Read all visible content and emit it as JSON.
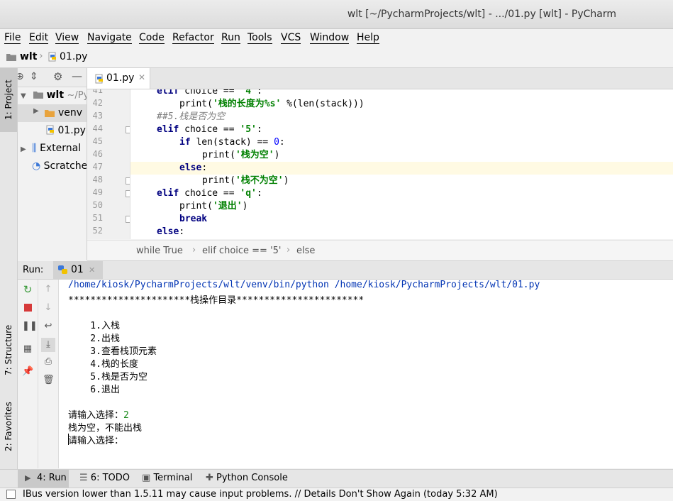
{
  "window": {
    "title": "wlt [~/PycharmProjects/wlt] - .../01.py [wlt] - PyCharm"
  },
  "menu": [
    "File",
    "Edit",
    "View",
    "Navigate",
    "Code",
    "Refactor",
    "Run",
    "Tools",
    "VCS",
    "Window",
    "Help"
  ],
  "nav": {
    "project": "wlt",
    "file": "01.py"
  },
  "sidebar": {
    "project_tab": "1: Project",
    "structure_tab": "7: Structure",
    "favorites_tab": "2: Favorites"
  },
  "project_tree": [
    {
      "label": "wlt",
      "suffix": "~/Py"
    },
    {
      "label": "venv"
    },
    {
      "label": "01.py"
    },
    {
      "label": "External"
    },
    {
      "label": "Scratche"
    }
  ],
  "editor": {
    "tab_label": "01.py",
    "lines": [
      {
        "n": "41",
        "text": "elif choice == '4':"
      },
      {
        "n": "42",
        "text": "print('栈的长度为%s' %(len(stack)))"
      },
      {
        "n": "43",
        "text": "##5.栈是否为空"
      },
      {
        "n": "44",
        "text": "elif choice == '5':"
      },
      {
        "n": "45",
        "text": "if len(stack) == 0:"
      },
      {
        "n": "46",
        "text": "print('栈为空')"
      },
      {
        "n": "47",
        "text": "else:"
      },
      {
        "n": "48",
        "text": "print('栈不为空')"
      },
      {
        "n": "49",
        "text": "elif choice == 'q':"
      },
      {
        "n": "50",
        "text": "print('退出')"
      },
      {
        "n": "51",
        "text": "break"
      },
      {
        "n": "52",
        "text": "else:"
      }
    ],
    "breadcrumbs": [
      "while True",
      "elif choice == '5'",
      "else"
    ]
  },
  "run": {
    "label": "Run:",
    "config": "01",
    "output": [
      "/home/kiosk/PycharmProjects/wlt/venv/bin/python /home/kiosk/PycharmProjects/wlt/01.py",
      "**********************栈操作目录***********************",
      "",
      "    1.入栈",
      "    2.出栈",
      "    3.查看栈顶元素",
      "    4.栈的长度",
      "    5.栈是否为空",
      "    6.退出",
      "",
      "请输入选择：",
      "栈为空，不能出栈",
      "请输入选择："
    ],
    "input_value": "2"
  },
  "bottom_tabs": [
    "4: Run",
    "6: TODO",
    "Terminal",
    "Python Console"
  ],
  "status": {
    "message": "IBus version lower than 1.5.11 may cause input problems. // Details Don't Show Again (today 5:32 AM)"
  },
  "colors": {
    "keyword": "#000080",
    "string": "#008000",
    "number": "#0000ff",
    "comment": "#808080",
    "current_line": "#fffae3",
    "link_blue": "#0033b3"
  }
}
